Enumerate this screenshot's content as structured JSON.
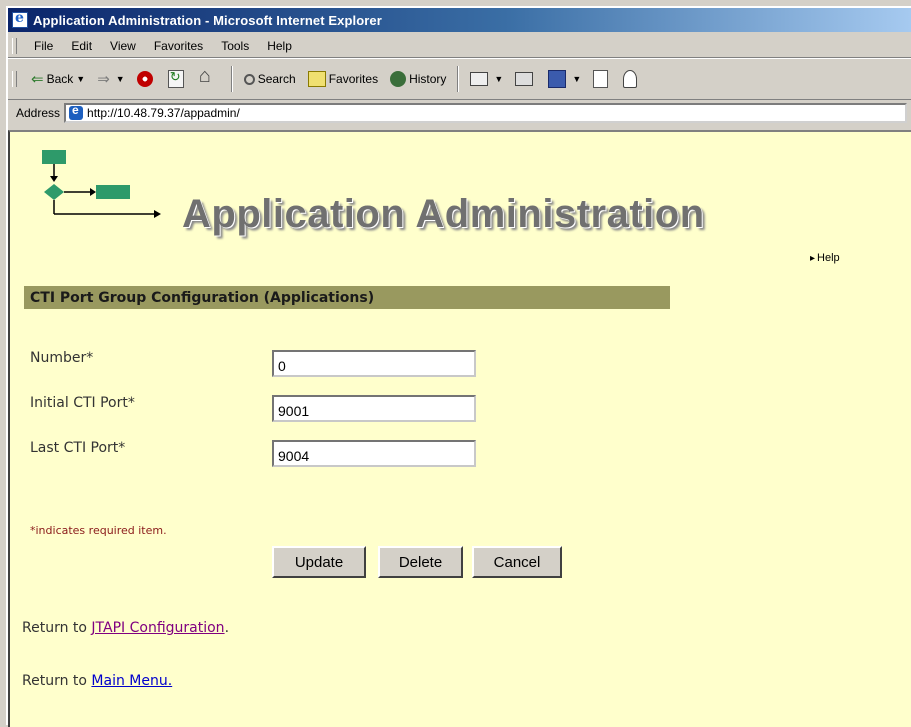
{
  "window": {
    "title": "Application Administration - Microsoft Internet Explorer"
  },
  "menu": [
    "File",
    "Edit",
    "View",
    "Favorites",
    "Tools",
    "Help"
  ],
  "toolbar": {
    "back": "Back",
    "search": "Search",
    "favorites": "Favorites",
    "history": "History"
  },
  "address": {
    "label": "Address",
    "url": "http://10.48.79.37/appadmin/"
  },
  "page": {
    "banner_title": "Application Administration",
    "help": "Help",
    "section_title": "CTI Port Group Configuration (Applications)",
    "fields": [
      {
        "label": "Number*",
        "value": "0"
      },
      {
        "label": "Initial CTI Port*",
        "value": "9001"
      },
      {
        "label": "Last CTI Port*",
        "value": "9004"
      }
    ],
    "required_note": "*indicates required item.",
    "buttons": {
      "update": "Update",
      "delete": "Delete",
      "cancel": "Cancel"
    },
    "return_jtapi": {
      "prefix": "Return to ",
      "link": "JTAPI Configuration",
      "suffix": "."
    },
    "return_main": {
      "prefix": "Return to ",
      "link": "Main Menu."
    }
  },
  "colors": {
    "content_bg": "#ffffcc",
    "section_bar": "#99995f",
    "logo_green": "#2e9a6a",
    "link_visited": "#800080",
    "link": "#0000cc"
  },
  "icons": [
    "stop-icon",
    "refresh-icon",
    "home-icon",
    "search-icon",
    "favorites-icon",
    "history-icon",
    "mail-icon",
    "print-icon",
    "edit-icon",
    "discuss-icon",
    "messenger-icon"
  ]
}
